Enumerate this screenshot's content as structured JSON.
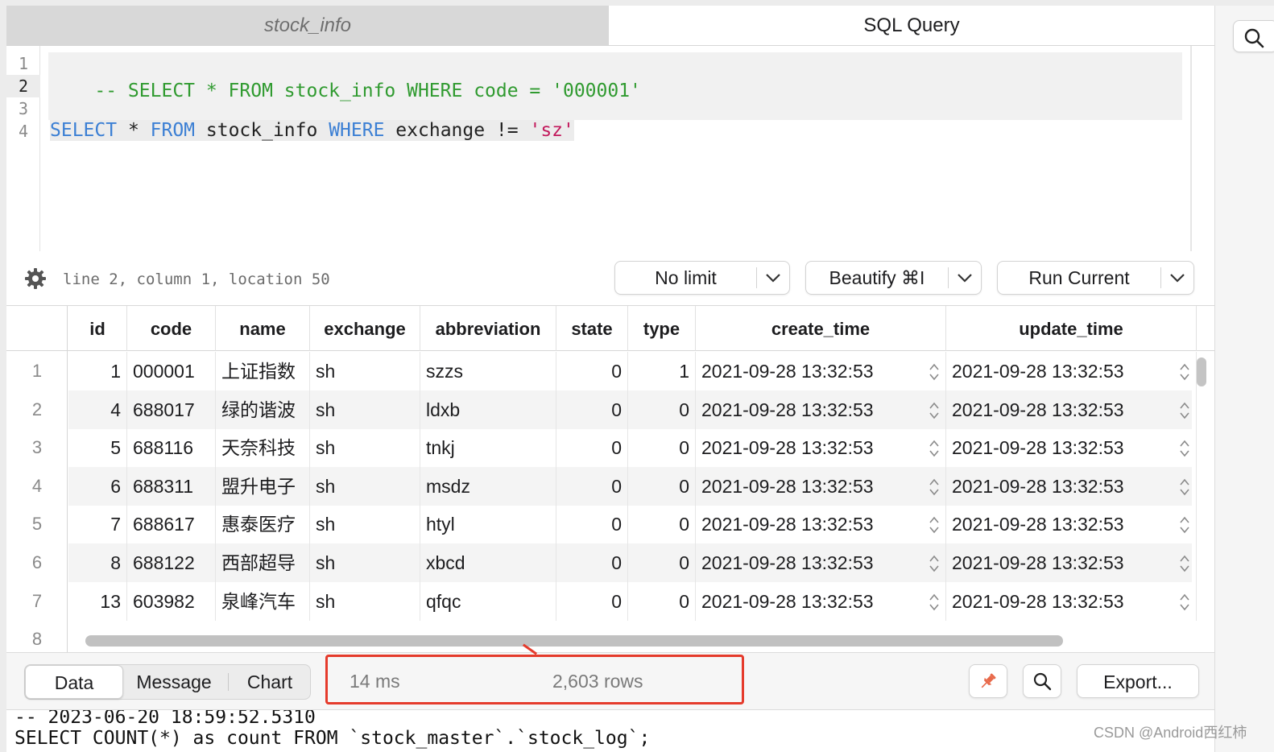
{
  "tabs": [
    {
      "label": "stock_info",
      "active": false
    },
    {
      "label": "SQL Query",
      "active": true
    }
  ],
  "editor": {
    "line_numbers": [
      "1",
      "2",
      "3",
      "4"
    ],
    "current_line": 2,
    "line1": {
      "comment": "-- SELECT * FROM stock_info WHERE code = '000001'"
    },
    "line4": {
      "kw1": "SELECT",
      "star": " * ",
      "kw2": "FROM",
      "table": " stock_info ",
      "kw3": "WHERE",
      "cond": " exchange != ",
      "value": "'sz'"
    }
  },
  "status": {
    "cursor_position": "line 2, column 1, location 50",
    "limit_label": "No limit",
    "beautify_label": "Beautify ⌘I",
    "run_label": "Run Current"
  },
  "grid": {
    "columns": [
      "id",
      "code",
      "name",
      "exchange",
      "abbreviation",
      "state",
      "type",
      "create_time",
      "update_time"
    ],
    "row_numbers": [
      "1",
      "2",
      "3",
      "4",
      "5",
      "6",
      "7",
      "8"
    ],
    "rows": [
      {
        "id": "1",
        "code": "000001",
        "name": "上证指数",
        "exchange": "sh",
        "abbreviation": "szzs",
        "state": "0",
        "type": "1",
        "create_time": "2021-09-28 13:32:53",
        "update_time": "2021-09-28 13:32:53"
      },
      {
        "id": "4",
        "code": "688017",
        "name": "绿的谐波",
        "exchange": "sh",
        "abbreviation": "ldxb",
        "state": "0",
        "type": "0",
        "create_time": "2021-09-28 13:32:53",
        "update_time": "2021-09-28 13:32:53"
      },
      {
        "id": "5",
        "code": "688116",
        "name": "天奈科技",
        "exchange": "sh",
        "abbreviation": "tnkj",
        "state": "0",
        "type": "0",
        "create_time": "2021-09-28 13:32:53",
        "update_time": "2021-09-28 13:32:53"
      },
      {
        "id": "6",
        "code": "688311",
        "name": "盟升电子",
        "exchange": "sh",
        "abbreviation": "msdz",
        "state": "0",
        "type": "0",
        "create_time": "2021-09-28 13:32:53",
        "update_time": "2021-09-28 13:32:53"
      },
      {
        "id": "7",
        "code": "688617",
        "name": "惠泰医疗",
        "exchange": "sh",
        "abbreviation": "htyl",
        "state": "0",
        "type": "0",
        "create_time": "2021-09-28 13:32:53",
        "update_time": "2021-09-28 13:32:53"
      },
      {
        "id": "8",
        "code": "688122",
        "name": "西部超导",
        "exchange": "sh",
        "abbreviation": "xbcd",
        "state": "0",
        "type": "0",
        "create_time": "2021-09-28 13:32:53",
        "update_time": "2021-09-28 13:32:53"
      },
      {
        "id": "13",
        "code": "603982",
        "name": "泉峰汽车",
        "exchange": "sh",
        "abbreviation": "qfqc",
        "state": "0",
        "type": "0",
        "create_time": "2021-09-28 13:32:53",
        "update_time": "2021-09-28 13:32:53"
      }
    ]
  },
  "results_bar": {
    "tabs": [
      "Data",
      "Message",
      "Chart"
    ],
    "active_tab": "Data",
    "timing": "14 ms",
    "row_count": "2,603 rows",
    "export_label": "Export...",
    "highlight_color": "#e53b2c"
  },
  "log": {
    "lines": [
      "-- 2023-06-20 18:59:52.5310",
      "SELECT COUNT(*) as count FROM `stock_master`.`stock_log`;"
    ]
  },
  "watermark": "CSDN @Android西红柿",
  "icons": [
    "search-icon",
    "gear-icon",
    "chevron-down-icon",
    "pin-icon",
    "stepper-icon"
  ]
}
